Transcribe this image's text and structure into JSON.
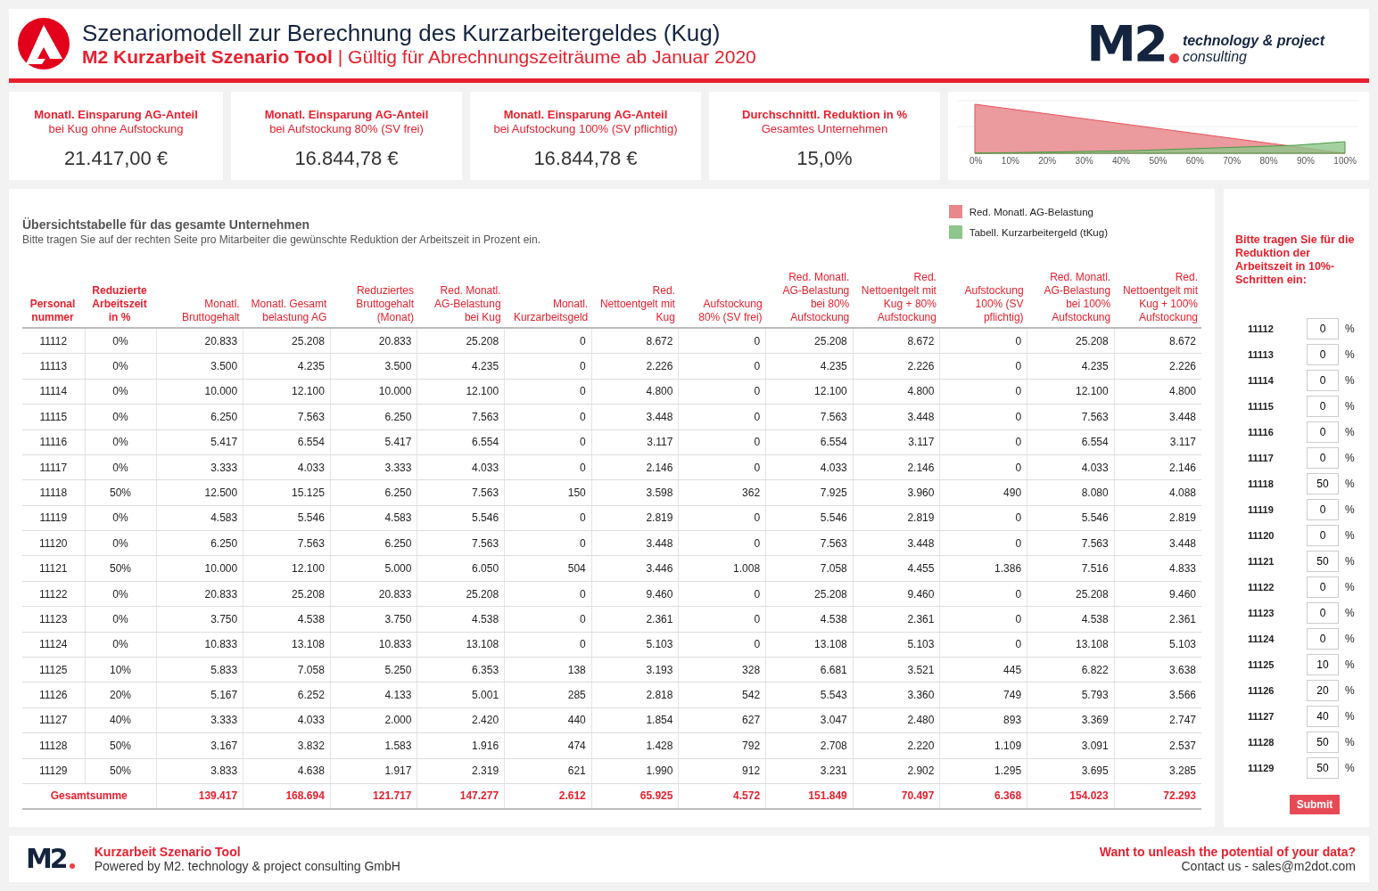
{
  "header": {
    "title": "Szenariomodell zur Berechnung des Kurzarbeitergeldes (Kug)",
    "subtitle_bold": "M2 Kurzarbeit Szenario Tool",
    "subtitle_rest": "| Gültig für Abrechnungszeiträume ab Januar 2020",
    "logo": {
      "mark": "M2",
      "line_1": "technology & project",
      "line_2": "consulting"
    }
  },
  "kpis": [
    {
      "title": "Monatl. Einsparung AG-Anteil",
      "subtitle": "bei Kug ohne Aufstockung",
      "value": "21.417,00 €"
    },
    {
      "title": "Monatl. Einsparung AG-Anteil",
      "subtitle": "bei Aufstockung 80% (SV frei)",
      "value": "16.844,78 €"
    },
    {
      "title": "Monatl. Einsparung AG-Anteil",
      "subtitle": "bei Aufstockung 100% (SV pflichtig)",
      "value": "16.844,78 €"
    },
    {
      "title": "Durchschnittl. Reduktion in %",
      "subtitle": "Gesamtes Unternehmen",
      "value": "15,0%"
    }
  ],
  "chart": {
    "x_labels": [
      "0%",
      "10%",
      "20%",
      "30%",
      "40%",
      "50%",
      "60%",
      "70%",
      "80%",
      "90%",
      "100%"
    ]
  },
  "table_panel": {
    "title": "Übersichtstabelle für das gesamte Unternehmen",
    "subtitle": "Bitte tragen Sie auf der rechten Seite pro Mitarbeiter die gewünschte Reduktion der Arbeitszeit in Prozent ein.",
    "legend": [
      {
        "label": "Red. Monatl. AG-Belastung",
        "color": "#e8888c"
      },
      {
        "label": "Tabell. Kurzarbeitergeld (tKug)",
        "color": "#8dc58a"
      }
    ],
    "columns": [
      "Personal nummer",
      "Reduzierte Arbeitszeit in %",
      "Monatl. Bruttogehalt",
      "Monatl. Gesamt belastung AG",
      "Reduziertes Bruttogehalt (Monat)",
      "Red. Monatl. AG-Belastung bei Kug",
      "Monatl. Kurzarbeitsgeld",
      "Red. Nettoentgelt mit Kug",
      "Aufstockung 80% (SV frei)",
      "Red. Monatl. AG-Belastung bei 80% Aufstockung",
      "Red. Nettoentgelt mit Kug + 80% Aufstockung",
      "Aufstockung 100% (SV pflichtig)",
      "Red. Monatl. AG-Belastung bei 100% Aufstockung",
      "Red. Nettoentgelt mit Kug + 100% Aufstockung"
    ],
    "rows": [
      [
        "11112",
        "0%",
        "20.833",
        "25.208",
        "20.833",
        "25.208",
        "0",
        "8.672",
        "0",
        "25.208",
        "8.672",
        "0",
        "25.208",
        "8.672"
      ],
      [
        "11113",
        "0%",
        "3.500",
        "4.235",
        "3.500",
        "4.235",
        "0",
        "2.226",
        "0",
        "4.235",
        "2.226",
        "0",
        "4.235",
        "2.226"
      ],
      [
        "11114",
        "0%",
        "10.000",
        "12.100",
        "10.000",
        "12.100",
        "0",
        "4.800",
        "0",
        "12.100",
        "4.800",
        "0",
        "12.100",
        "4.800"
      ],
      [
        "11115",
        "0%",
        "6.250",
        "7.563",
        "6.250",
        "7.563",
        "0",
        "3.448",
        "0",
        "7.563",
        "3.448",
        "0",
        "7.563",
        "3.448"
      ],
      [
        "11116",
        "0%",
        "5.417",
        "6.554",
        "5.417",
        "6.554",
        "0",
        "3.117",
        "0",
        "6.554",
        "3.117",
        "0",
        "6.554",
        "3.117"
      ],
      [
        "11117",
        "0%",
        "3.333",
        "4.033",
        "3.333",
        "4.033",
        "0",
        "2.146",
        "0",
        "4.033",
        "2.146",
        "0",
        "4.033",
        "2.146"
      ],
      [
        "11118",
        "50%",
        "12.500",
        "15.125",
        "6.250",
        "7.563",
        "150",
        "3.598",
        "362",
        "7.925",
        "3.960",
        "490",
        "8.080",
        "4.088"
      ],
      [
        "11119",
        "0%",
        "4.583",
        "5.546",
        "4.583",
        "5.546",
        "0",
        "2.819",
        "0",
        "5.546",
        "2.819",
        "0",
        "5.546",
        "2.819"
      ],
      [
        "11120",
        "0%",
        "6.250",
        "7.563",
        "6.250",
        "7.563",
        "0",
        "3.448",
        "0",
        "7.563",
        "3.448",
        "0",
        "7.563",
        "3.448"
      ],
      [
        "11121",
        "50%",
        "10.000",
        "12.100",
        "5.000",
        "6.050",
        "504",
        "3.446",
        "1.008",
        "7.058",
        "4.455",
        "1.386",
        "7.516",
        "4.833"
      ],
      [
        "11122",
        "0%",
        "20.833",
        "25.208",
        "20.833",
        "25.208",
        "0",
        "9.460",
        "0",
        "25.208",
        "9.460",
        "0",
        "25.208",
        "9.460"
      ],
      [
        "11123",
        "0%",
        "3.750",
        "4.538",
        "3.750",
        "4.538",
        "0",
        "2.361",
        "0",
        "4.538",
        "2.361",
        "0",
        "4.538",
        "2.361"
      ],
      [
        "11124",
        "0%",
        "10.833",
        "13.108",
        "10.833",
        "13.108",
        "0",
        "5.103",
        "0",
        "13.108",
        "5.103",
        "0",
        "13.108",
        "5.103"
      ],
      [
        "11125",
        "10%",
        "5.833",
        "7.058",
        "5.250",
        "6.353",
        "138",
        "3.193",
        "328",
        "6.681",
        "3.521",
        "445",
        "6.822",
        "3.638"
      ],
      [
        "11126",
        "20%",
        "5.167",
        "6.252",
        "4.133",
        "5.001",
        "285",
        "2.818",
        "542",
        "5.543",
        "3.360",
        "749",
        "5.793",
        "3.566"
      ],
      [
        "11127",
        "40%",
        "3.333",
        "4.033",
        "2.000",
        "2.420",
        "440",
        "1.854",
        "627",
        "3.047",
        "2.480",
        "893",
        "3.369",
        "2.747"
      ],
      [
        "11128",
        "50%",
        "3.167",
        "3.832",
        "1.583",
        "1.916",
        "474",
        "1.428",
        "792",
        "2.708",
        "2.220",
        "1.109",
        "3.091",
        "2.537"
      ],
      [
        "11129",
        "50%",
        "3.833",
        "4.638",
        "1.917",
        "2.319",
        "621",
        "1.990",
        "912",
        "3.231",
        "2.902",
        "1.295",
        "3.695",
        "3.285"
      ]
    ],
    "total": {
      "label": "Gesamtsumme",
      "values": [
        "139.417",
        "168.694",
        "121.717",
        "147.277",
        "2.612",
        "65.925",
        "4.572",
        "151.849",
        "70.497",
        "6.368",
        "154.023",
        "72.293"
      ]
    }
  },
  "input_panel": {
    "title": "Bitte tragen Sie für die Reduktion der Arbeitszeit in 10%-Schritten ein:",
    "unit": "%",
    "submit": "Submit",
    "inputs": [
      {
        "id": "11112",
        "value": "0"
      },
      {
        "id": "11113",
        "value": "0"
      },
      {
        "id": "11114",
        "value": "0"
      },
      {
        "id": "11115",
        "value": "0"
      },
      {
        "id": "11116",
        "value": "0"
      },
      {
        "id": "11117",
        "value": "0"
      },
      {
        "id": "11118",
        "value": "50"
      },
      {
        "id": "11119",
        "value": "0"
      },
      {
        "id": "11120",
        "value": "0"
      },
      {
        "id": "11121",
        "value": "50"
      },
      {
        "id": "11122",
        "value": "0"
      },
      {
        "id": "11123",
        "value": "0"
      },
      {
        "id": "11124",
        "value": "0"
      },
      {
        "id": "11125",
        "value": "10"
      },
      {
        "id": "11126",
        "value": "20"
      },
      {
        "id": "11127",
        "value": "40"
      },
      {
        "id": "11128",
        "value": "50"
      },
      {
        "id": "11129",
        "value": "50"
      }
    ]
  },
  "footer": {
    "logo": "M2",
    "title": "Kurzarbeit Szenario Tool",
    "subtitle": "Powered by M2. technology & project consulting GmbH",
    "cta": "Want to unleash the potential of your data?",
    "contact": "Contact us - sales@m2dot.com"
  }
}
